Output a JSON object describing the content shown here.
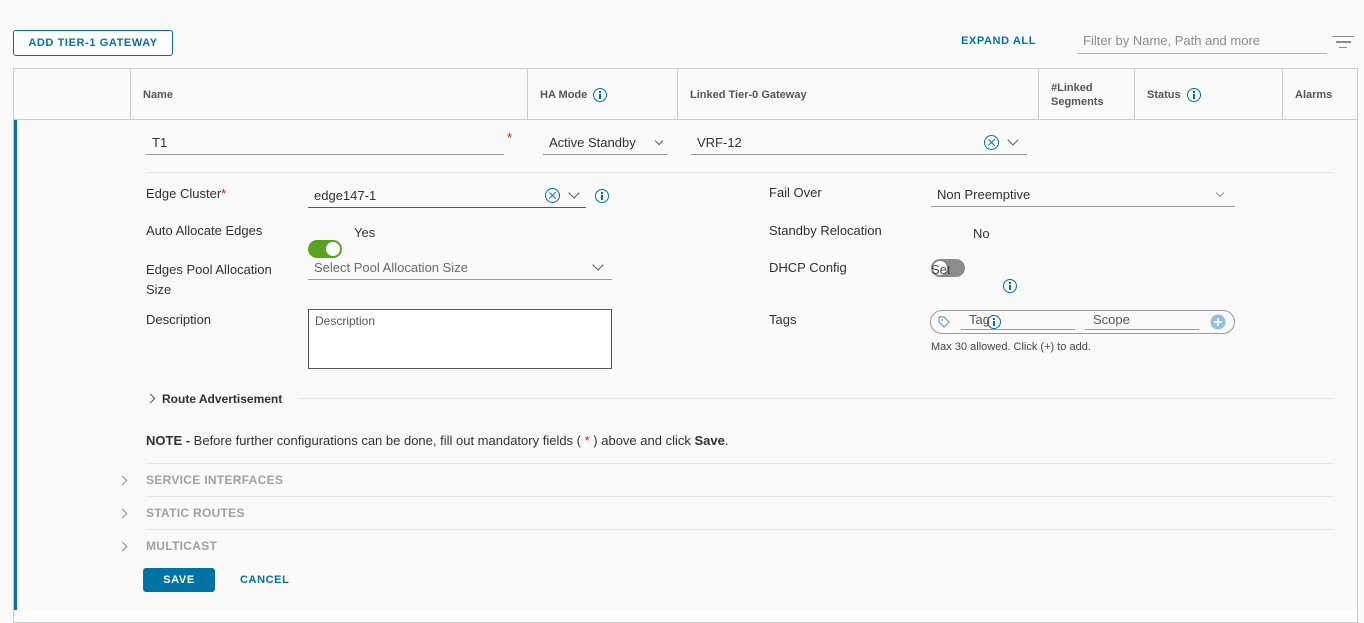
{
  "toolbar": {
    "add_label": "ADD TIER-1 GATEWAY",
    "expand_label": "EXPAND ALL",
    "filter_placeholder": "Filter by Name, Path and more"
  },
  "columns": {
    "name": "Name",
    "ha_mode": "HA Mode",
    "linked_tier0": "Linked Tier-0 Gateway",
    "linked_segments_1": "#Linked",
    "linked_segments_2": "Segments",
    "status": "Status",
    "alarms": "Alarms"
  },
  "row": {
    "name_value": "T1",
    "required_mark": "*",
    "ha_mode_value": "Active Standby",
    "tier0_value": "VRF-12"
  },
  "form": {
    "edge_cluster_label": "Edge Cluster",
    "edge_cluster_value": "edge147-1",
    "auto_allocate_label": "Auto Allocate Edges",
    "auto_allocate_value": "Yes",
    "pool_label_1": "Edges Pool Allocation",
    "pool_label_2": "Size",
    "pool_placeholder": "Select Pool Allocation Size",
    "description_label": "Description",
    "description_placeholder": "Description",
    "fail_over_label": "Fail Over",
    "fail_over_value": "Non Preemptive",
    "standby_label": "Standby Relocation",
    "standby_value": "No",
    "dhcp_label": "DHCP Config",
    "dhcp_value": "Set",
    "tags_label": "Tags",
    "tag_placeholder": "Tag",
    "scope_placeholder": "Scope",
    "tags_hint": "Max 30 allowed. Click (+) to add."
  },
  "sections": {
    "route_adv": "Route Advertisement",
    "note_bold": "NOTE -",
    "note_text_1": " Before further configurations can be done, fill out mandatory fields ( ",
    "note_star": "*",
    "note_text_2": " ) above and click ",
    "note_save": "Save",
    "note_end": ".",
    "service_interfaces": "SERVICE INTERFACES",
    "static_routes": "STATIC ROUTES",
    "multicast": "MULTICAST"
  },
  "actions": {
    "save": "SAVE",
    "cancel": "CANCEL"
  },
  "icons": [
    "info-icon",
    "clear-icon",
    "chevron-down-icon",
    "chevron-right-icon",
    "tag-icon",
    "plus-icon",
    "filter-icon"
  ],
  "colors": {
    "accent": "#0072a3",
    "toggle_on": "#5aa220",
    "toggle_off": "#8c8c8c",
    "required": "#c21d00"
  }
}
